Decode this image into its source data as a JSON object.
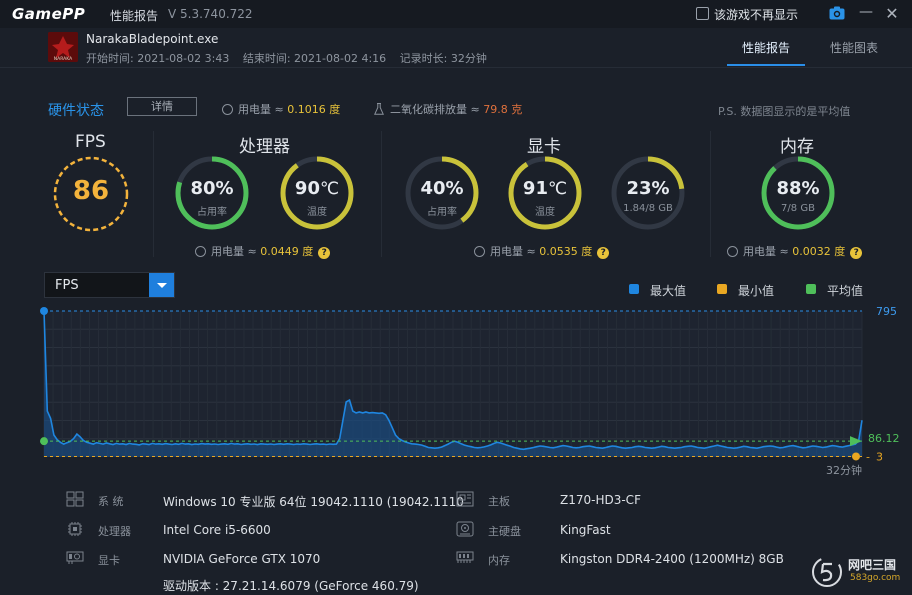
{
  "app": {
    "logo": "GamePP",
    "title": "性能报告",
    "version": "V 5.3.740.722",
    "dont_show_label": "该游戏不再显示"
  },
  "game": {
    "name": "NarakaBladepoint.exe",
    "icon_text": "NARAKA",
    "start_time": "开始时间: 2021-08-02 3:43",
    "end_time": "结束时间: 2021-08-02 4:16",
    "duration": "记录时长: 32分钟"
  },
  "tabs": [
    {
      "label": "性能报告",
      "active": true
    },
    {
      "label": "性能图表",
      "active": false
    }
  ],
  "status": {
    "title": "硬件状态",
    "detail_button": "详情",
    "power_total_label": "用电量 ≈ ",
    "power_total_value": "0.1016 度",
    "co2_label": "二氧化碳排放量 ≈ ",
    "co2_value": "79.8 克",
    "note": "P.S. 数据图显示的是平均值"
  },
  "fps": {
    "title": "FPS",
    "value": "86"
  },
  "cpu": {
    "title": "处理器",
    "usage": {
      "value": "80%",
      "label": "占用率",
      "fraction": 0.8,
      "color": "#4fbf5a"
    },
    "temp": {
      "value": "90",
      "unit": "℃",
      "label": "温度",
      "fraction": 0.9,
      "color": "#c9c23a"
    },
    "power_label": "用电量 ≈ ",
    "power_value": "0.0449 度"
  },
  "gpu": {
    "title": "显卡",
    "usage": {
      "value": "40%",
      "label": "占用率",
      "fraction": 0.4,
      "color": "#c9c23a"
    },
    "temp": {
      "value": "91",
      "unit": "℃",
      "label": "温度",
      "fraction": 0.91,
      "color": "#c9c23a"
    },
    "mem": {
      "value": "23%",
      "label": "1.84/8 GB",
      "fraction": 0.23,
      "color": "#c9c23a"
    },
    "power_label": "用电量 ≈ ",
    "power_value": "0.0535 度"
  },
  "ram": {
    "title": "内存",
    "usage": {
      "value": "88%",
      "label": "7/8 GB",
      "fraction": 0.88,
      "color": "#4fbf5a"
    },
    "power_label": "用电量 ≈ ",
    "power_value": "0.0032 度"
  },
  "chart_toolbar": {
    "metric": "FPS",
    "legend": [
      {
        "label": "最大值",
        "color": "#1f86e0"
      },
      {
        "label": "最小值",
        "color": "#e9a722"
      },
      {
        "label": "平均值",
        "color": "#4fbf5a"
      }
    ]
  },
  "chart_data": {
    "type": "area",
    "title": "",
    "xlabel": "",
    "ylabel": "",
    "x_end_label": "32分钟",
    "max_label": "795",
    "avg_label": "86.12",
    "min_label": "3",
    "max": 795,
    "min": 3,
    "avg": 86.12,
    "ylim": [
      0,
      795
    ],
    "x_minutes": 32,
    "grid": true,
    "series": [
      {
        "values": [
          795,
          250,
          210,
          120,
          95,
          80,
          70,
          78,
          85,
          100,
          125,
          110,
          90,
          80,
          75,
          70,
          78,
          74,
          70,
          76,
          72,
          68,
          74,
          70,
          72,
          68,
          74,
          70,
          69,
          66,
          72,
          70,
          68,
          74,
          70,
          72,
          69,
          73,
          70,
          68,
          72,
          69,
          74,
          70,
          72,
          68,
          71,
          69,
          73,
          70,
          72,
          69,
          71,
          68,
          70,
          72,
          69,
          74,
          70,
          72,
          68,
          70,
          72,
          69,
          71,
          68,
          72,
          70,
          69,
          71,
          68,
          70,
          72,
          69,
          72,
          70,
          68,
          71,
          69,
          72,
          70,
          68,
          70,
          72,
          69,
          70,
          68,
          71,
          69,
          70,
          100,
          200,
          300,
          310,
          250,
          240,
          245,
          240,
          245,
          240,
          242,
          240,
          238,
          240,
          230,
          200,
          160,
          120,
          100,
          90,
          82,
          76,
          72,
          70,
          68,
          65,
          58,
          52,
          50,
          48,
          50,
          54,
          62,
          70,
          80,
          86,
          80,
          72,
          65,
          60,
          56,
          52,
          50,
          52,
          55,
          60,
          66,
          74,
          80,
          76,
          70,
          64,
          58,
          52,
          48,
          44,
          42,
          45,
          48,
          52,
          56,
          60,
          58,
          55,
          52,
          50,
          54,
          58,
          62,
          60,
          56,
          52,
          50,
          52,
          56,
          58,
          60,
          56,
          52,
          50,
          48,
          52,
          56,
          60,
          58,
          54,
          50,
          48,
          50,
          52,
          56,
          58,
          56,
          52,
          50,
          48,
          50,
          54,
          58,
          56,
          52,
          50,
          48,
          50,
          52,
          56,
          58,
          60,
          56,
          52,
          50,
          48,
          52,
          56,
          60,
          64,
          60,
          56,
          52,
          50,
          48,
          50,
          54,
          58,
          56,
          52,
          50,
          48,
          52,
          56,
          58,
          60,
          58,
          54,
          50,
          52,
          56,
          60,
          62,
          58,
          54,
          50,
          52,
          56,
          60,
          58,
          55,
          52,
          54,
          58,
          62,
          60,
          56,
          54,
          58,
          62,
          66,
          70,
          90,
          200
        ]
      }
    ]
  },
  "system_info": [
    {
      "icon": "windows-icon",
      "label": "系 统",
      "value": "Windows 10 专业版 64位   19042.1110 (19042.1110"
    },
    {
      "icon": "cpu-icon",
      "label": "处理器",
      "value": "Intel Core i5-6600"
    },
    {
      "icon": "gpu-icon",
      "label": "显卡",
      "value": "NVIDIA GeForce GTX 1070"
    },
    {
      "icon": "",
      "label": "",
      "value": "驱动版本 : 27.21.14.6079 (GeForce 460.79)"
    },
    {
      "icon": "motherboard-icon",
      "label": "主板",
      "value": "Z170-HD3-CF"
    },
    {
      "icon": "harddisk-icon",
      "label": "主硬盘",
      "value": "KingFast"
    },
    {
      "icon": "memory-icon",
      "label": "内存",
      "value": "Kingston DDR4-2400 (1200MHz) 8GB"
    }
  ],
  "watermark": {
    "name": "网吧三国",
    "domain": "583go.com"
  }
}
